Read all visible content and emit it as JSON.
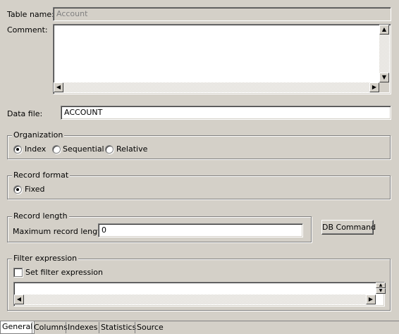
{
  "general": {
    "table_name_label": "Table name:",
    "table_name_value": "Account",
    "comment_label": "Comment:",
    "comment_value": "",
    "data_file_label": "Data file:",
    "data_file_value": "ACCOUNT"
  },
  "organization": {
    "legend": "Organization",
    "options": [
      {
        "label": "Index",
        "checked": true
      },
      {
        "label": "Sequential",
        "checked": false
      },
      {
        "label": "Relative",
        "checked": false
      }
    ]
  },
  "record_format": {
    "legend": "Record format",
    "options": [
      {
        "label": "Fixed",
        "checked": true
      }
    ]
  },
  "record_length": {
    "legend": "Record length",
    "max_label": "Maximum record length:",
    "max_value": "0",
    "db_command_label": "DB Command"
  },
  "filter": {
    "legend": "Filter expression",
    "checkbox_label": "Set filter expression",
    "checked": false,
    "expression_value": ""
  },
  "tabs": [
    {
      "label": "General",
      "active": true
    },
    {
      "label": "Columns",
      "active": false
    },
    {
      "label": "Indexes",
      "active": false
    },
    {
      "label": "Statistics",
      "active": false
    },
    {
      "label": "Source",
      "active": false
    }
  ]
}
